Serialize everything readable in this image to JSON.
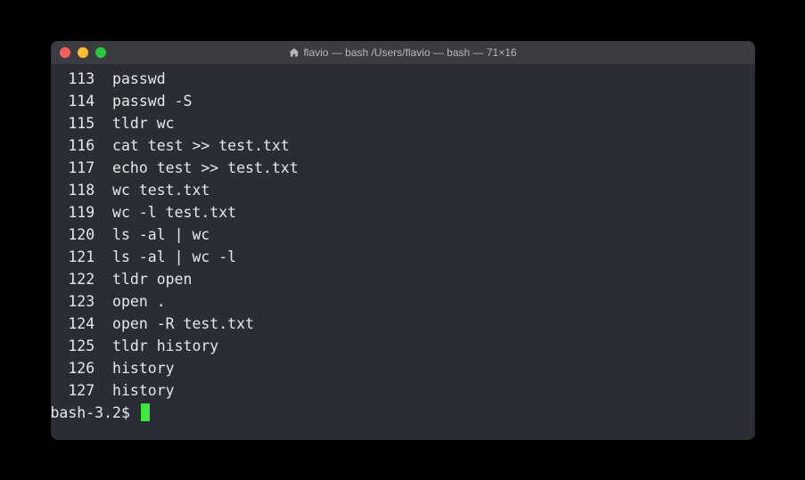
{
  "window": {
    "title": "flavio — bash /Users/flavio — bash — 71×16"
  },
  "history": [
    {
      "num": "113",
      "cmd": "passwd"
    },
    {
      "num": "114",
      "cmd": "passwd -S"
    },
    {
      "num": "115",
      "cmd": "tldr wc"
    },
    {
      "num": "116",
      "cmd": "cat test >> test.txt"
    },
    {
      "num": "117",
      "cmd": "echo test >> test.txt"
    },
    {
      "num": "118",
      "cmd": "wc test.txt"
    },
    {
      "num": "119",
      "cmd": "wc -l test.txt"
    },
    {
      "num": "120",
      "cmd": "ls -al | wc"
    },
    {
      "num": "121",
      "cmd": "ls -al | wc -l"
    },
    {
      "num": "122",
      "cmd": "tldr open"
    },
    {
      "num": "123",
      "cmd": "open ."
    },
    {
      "num": "124",
      "cmd": "open -R test.txt"
    },
    {
      "num": "125",
      "cmd": "tldr history"
    },
    {
      "num": "126",
      "cmd": "history"
    },
    {
      "num": "127",
      "cmd": "history"
    }
  ],
  "prompt": "bash-3.2$ "
}
